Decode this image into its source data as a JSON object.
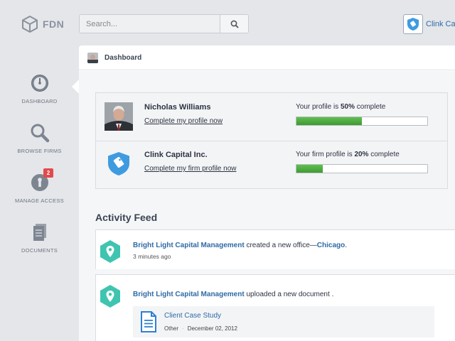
{
  "logo": {
    "text": "FDN",
    "icon": "hexagon-cube-logo"
  },
  "search": {
    "placeholder": "Search...",
    "icon": "search-icon"
  },
  "account": {
    "company_name": "Clink Capi"
  },
  "sidebar": {
    "items": [
      {
        "label": "DASHBOARD",
        "icon": "gauge-icon",
        "active": true
      },
      {
        "label": "BROWSE FIRMS",
        "icon": "magnifier-icon"
      },
      {
        "label": "MANAGE ACCESS",
        "icon": "key-lock-icon",
        "badge": "2"
      },
      {
        "label": "DOCUMENTS",
        "icon": "documents-icon"
      }
    ]
  },
  "page": {
    "title": "Dashboard"
  },
  "profiles": [
    {
      "name": "Nicholas Williams",
      "link": "Complete my profile now",
      "status_prefix": "Your profile is ",
      "percent_label": "50%",
      "status_suffix": " complete",
      "progress": 0.5
    },
    {
      "name": "Clink Capital Inc.",
      "link": "Complete my firm profile now",
      "status_prefix": "Your firm profile is ",
      "percent_label": "20%",
      "status_suffix": " complete",
      "progress": 0.2
    }
  ],
  "feed": {
    "title": "Activity Feed",
    "items": [
      {
        "actor": "Bright Light Capital Management",
        "action": " created a new office—",
        "object": "Chicago",
        "tail": ".",
        "time": "3 minutes ago"
      },
      {
        "actor": "Bright Light Capital Management",
        "action": " uploaded a new document .",
        "document": {
          "title": "Client Case Study",
          "type": "Other",
          "date": "December 02, 2012"
        }
      }
    ]
  },
  "colors": {
    "accent": "#2e6aa6",
    "progress": "#4aaa3c",
    "pin": "#3fc4b0",
    "badge": "#e24a4a",
    "shield": "#3f9be0"
  }
}
